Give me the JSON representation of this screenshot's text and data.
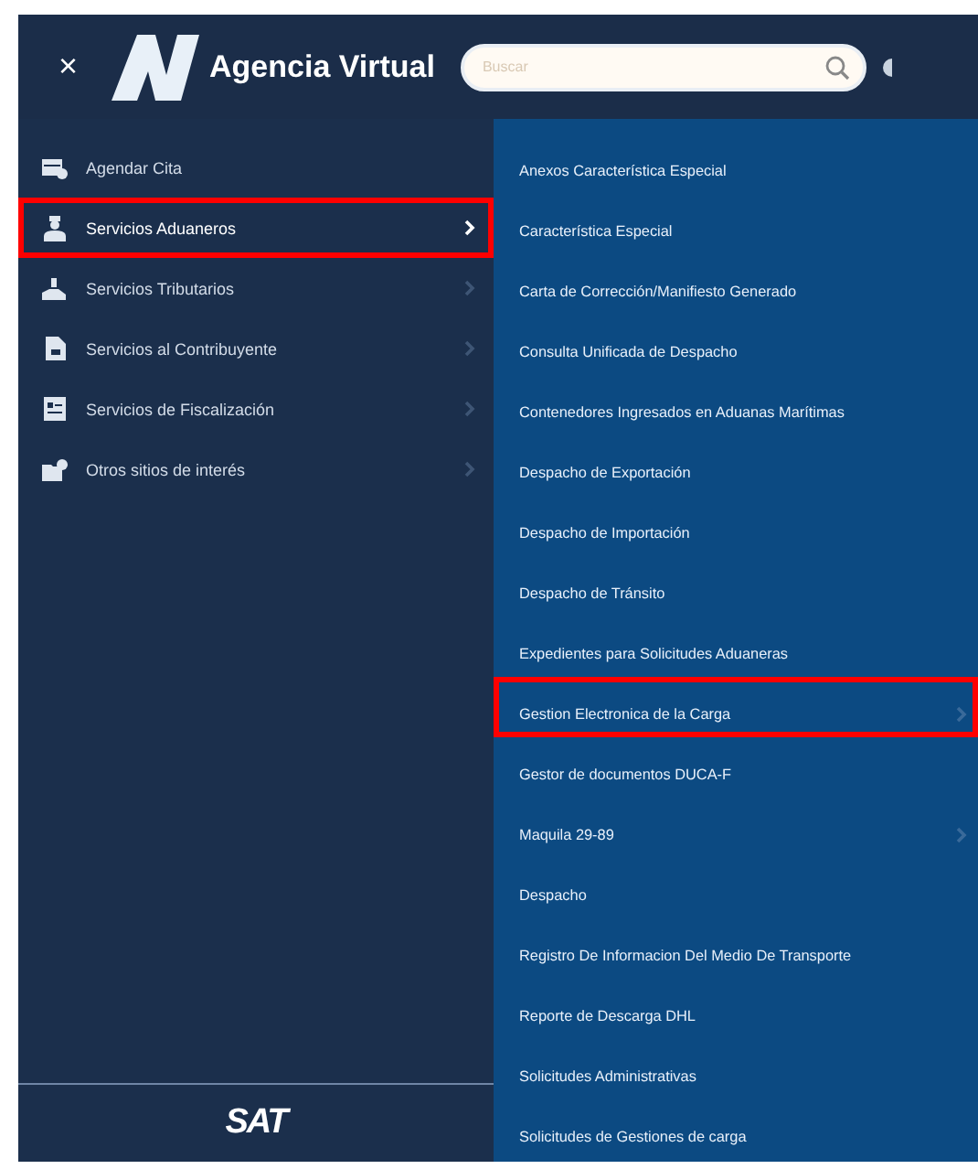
{
  "header": {
    "close": "×",
    "app_title": "Agencia Virtual",
    "search": {
      "placeholder": "Buscar"
    }
  },
  "sidebar": {
    "items": [
      {
        "label": "Agendar Cita",
        "kind": "calendar",
        "has_submenu": false,
        "expanded": false,
        "highlighted": false
      },
      {
        "label": "Servicios Aduaneros",
        "kind": "person",
        "has_submenu": true,
        "expanded": true,
        "highlighted": true
      },
      {
        "label": "Servicios Tributarios",
        "kind": "hand",
        "has_submenu": true,
        "expanded": false,
        "highlighted": false
      },
      {
        "label": "Servicios al Contribuyente",
        "kind": "document",
        "has_submenu": true,
        "expanded": false,
        "highlighted": false
      },
      {
        "label": "Servicios de Fiscalización",
        "kind": "card",
        "has_submenu": true,
        "expanded": false,
        "highlighted": false
      },
      {
        "label": "Otros sitios de interés",
        "kind": "folder",
        "has_submenu": true,
        "expanded": false,
        "highlighted": false
      }
    ],
    "footer_logo": "SAT"
  },
  "submenu": {
    "items": [
      {
        "label": "Anexos Característica Especial",
        "has_submenu": false,
        "highlighted": false
      },
      {
        "label": "Característica Especial",
        "has_submenu": false,
        "highlighted": false
      },
      {
        "label": "Carta de Corrección/Manifiesto Generado",
        "has_submenu": false,
        "highlighted": false
      },
      {
        "label": "Consulta Unificada de Despacho",
        "has_submenu": false,
        "highlighted": false
      },
      {
        "label": "Contenedores Ingresados en Aduanas Marítimas",
        "has_submenu": false,
        "highlighted": false
      },
      {
        "label": "Despacho de Exportación",
        "has_submenu": false,
        "highlighted": false
      },
      {
        "label": "Despacho de Importación",
        "has_submenu": false,
        "highlighted": false
      },
      {
        "label": "Despacho de Tránsito",
        "has_submenu": false,
        "highlighted": false
      },
      {
        "label": "Expedientes para Solicitudes Aduaneras",
        "has_submenu": false,
        "highlighted": false
      },
      {
        "label": "Gestion Electronica de la Carga",
        "has_submenu": true,
        "highlighted": true
      },
      {
        "label": "Gestor de documentos DUCA-F",
        "has_submenu": false,
        "highlighted": false
      },
      {
        "label": "Maquila 29-89",
        "has_submenu": true,
        "highlighted": false
      },
      {
        "label": "Despacho",
        "has_submenu": false,
        "highlighted": false
      },
      {
        "label": "Registro De Informacion Del Medio De Transporte",
        "has_submenu": false,
        "highlighted": false
      },
      {
        "label": "Reporte de Descarga DHL",
        "has_submenu": false,
        "highlighted": false
      },
      {
        "label": "Solicitudes Administrativas",
        "has_submenu": false,
        "highlighted": false
      },
      {
        "label": "Solicitudes de Gestiones de carga",
        "has_submenu": false,
        "highlighted": false
      }
    ]
  }
}
